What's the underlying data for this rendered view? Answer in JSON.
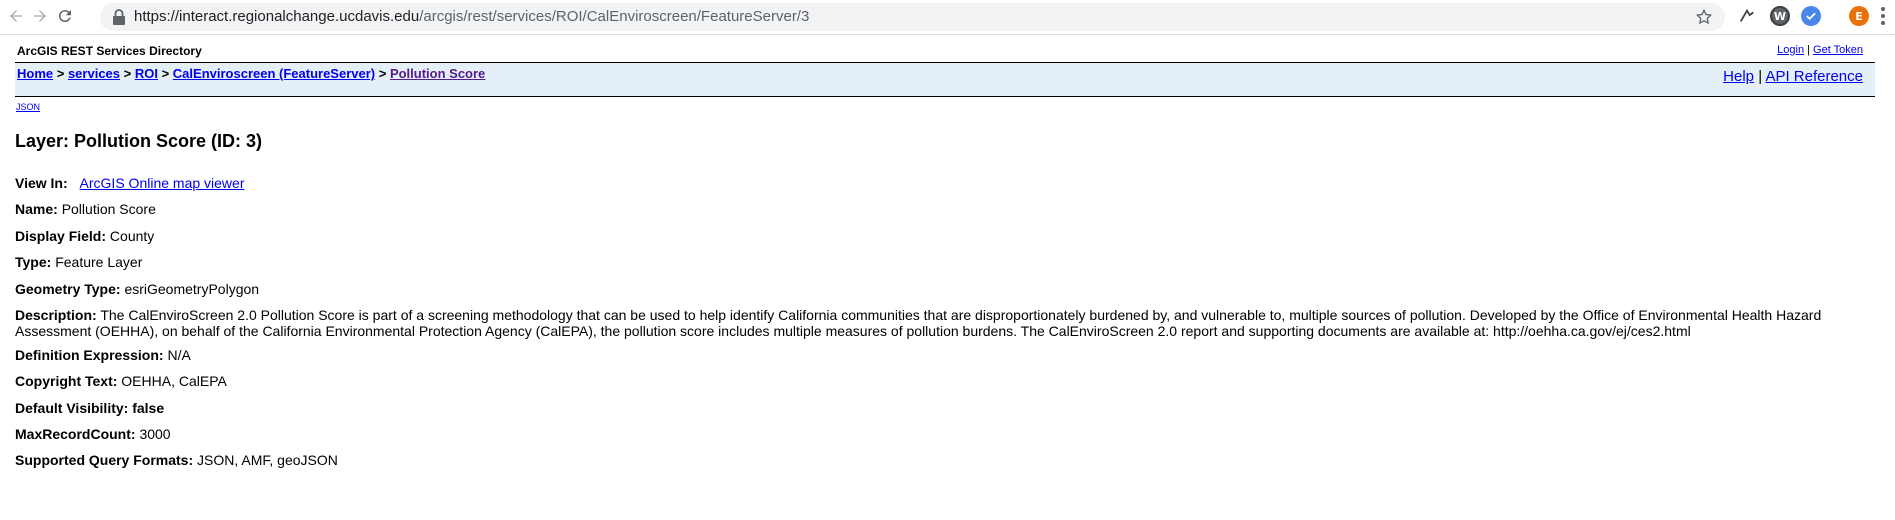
{
  "browser": {
    "url_host": "https://interact.regionalchange.ucdavis.edu",
    "url_path": "/arcgis/rest/services/ROI/CalEnviroscreen/FeatureServer/3",
    "profile_initial": "E",
    "ext_w_initial": "W"
  },
  "header": {
    "directory_title": "ArcGIS REST Services Directory",
    "login": "Login",
    "get_token": "Get Token",
    "separator": " | "
  },
  "breadcrumb": {
    "items": [
      "Home",
      "services",
      "ROI",
      "CalEnviroscreen (FeatureServer)",
      "Pollution Score"
    ],
    "separator": " > ",
    "help": "Help",
    "api_reference": "API Reference"
  },
  "json_link": "JSON",
  "layer": {
    "title": "Layer: Pollution Score (ID: 3)",
    "view_in_label": "View In:",
    "view_in_link": "ArcGIS Online map viewer",
    "fields": [
      {
        "label": "Name:",
        "value": "Pollution Score"
      },
      {
        "label": "Display Field:",
        "value": "County"
      },
      {
        "label": "Type:",
        "value": "Feature Layer"
      },
      {
        "label": "Geometry Type:",
        "value": "esriGeometryPolygon"
      },
      {
        "label": "Description:",
        "value": "The CalEnviroScreen 2.0 Pollution Score is part of a screening methodology that can be used to help identify California communities that are disproportionately burdened by, and vulnerable to, multiple sources of pollution. Developed by the Office of Environmental Health Hazard Assessment (OEHHA), on behalf of the California Environmental Protection Agency (CalEPA), the pollution score includes multiple measures of pollution burdens. The CalEnviroScreen 2.0 report and supporting documents are available at: http://oehha.ca.gov/ej/ces2.html"
      },
      {
        "label": "Definition Expression:",
        "value": "N/A"
      },
      {
        "label": "Copyright Text:",
        "value": "OEHHA, CalEPA"
      },
      {
        "label": "Default Visibility:",
        "value": "false"
      },
      {
        "label": "MaxRecordCount:",
        "value": "3000"
      },
      {
        "label": "Supported Query Formats:",
        "value": "JSON, AMF, geoJSON"
      }
    ]
  },
  "colors": {
    "link": "#0000ee",
    "visited": "#551a8b",
    "crumb_bg": "#e5eff7",
    "profile": "#e8710a"
  }
}
